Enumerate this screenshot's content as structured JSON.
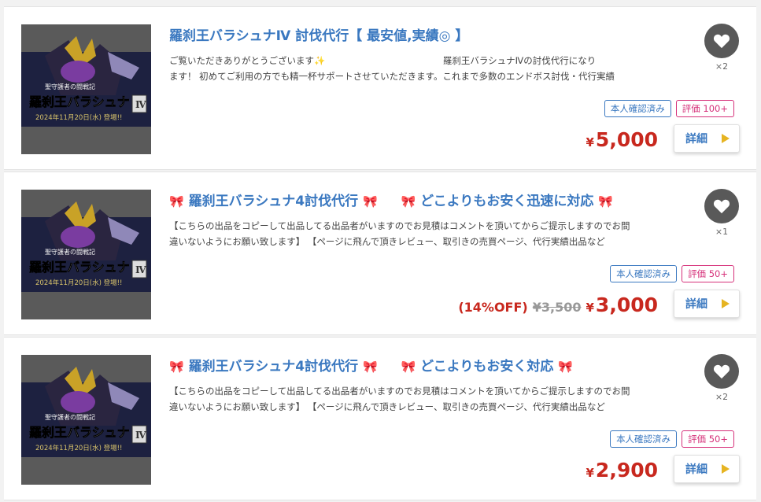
{
  "listings": [
    {
      "title": "羅刹王バラシュナⅣ 討伐代行【 最安値,実績◎ 】",
      "title_ribbons": false,
      "title_part1": "",
      "title_part2": "",
      "description_line1": "ご覧いただきありがとうございます✨　　　　　　　　　　　　　羅刹王バラシュナⅣの討伐代行になり",
      "description_line2": "ます！ 初めてご利用の方でも精一杯サポートさせていただきます。これまで多数のエンドボス討伐・代行実績",
      "favorite_count": "×2",
      "badge_verified": "本人確認済み",
      "badge_rating": "評価 100+",
      "discount_label": "",
      "original_price": "",
      "currency": "¥",
      "price": "5,000",
      "detail_label": "詳細"
    },
    {
      "title": "",
      "title_ribbons": true,
      "title_part1": "羅刹王バラシュナ4討伐代行",
      "title_part2": "どこよりもお安く迅速に対応",
      "description_line1": "【こちらの出品をコピーして出品してる出品者がいますのでお見積はコメントを頂いてからご提示しますのでお間",
      "description_line2": "違いないようにお願い致します】 【ページに飛んで頂きレビュー、取引きの売買ページ、代行実績出品など",
      "favorite_count": "×1",
      "badge_verified": "本人確認済み",
      "badge_rating": "評価 50+",
      "discount_label": "(14%OFF)",
      "original_price": "¥3,500",
      "currency": "¥",
      "price": "3,000",
      "detail_label": "詳細"
    },
    {
      "title": "",
      "title_ribbons": true,
      "title_part1": "羅刹王バラシュナ4討伐代行",
      "title_part2": "どこよりもお安く対応",
      "description_line1": "【こちらの出品をコピーして出品してる出品者がいますのでお見積はコメントを頂いてからご提示しますのでお間",
      "description_line2": "違いないようにお願い致します】 【ページに飛んで頂きレビュー、取引きの売買ページ、代行実績出品など",
      "favorite_count": "×2",
      "badge_verified": "本人確認済み",
      "badge_rating": "評価 50+",
      "discount_label": "",
      "original_price": "",
      "currency": "¥",
      "price": "2,900",
      "detail_label": "詳細"
    }
  ],
  "thumbnail": {
    "caption_small": "聖守護者の闘戦記",
    "caption_main": "羅刹王バラシュナ",
    "caption_date": "2024年11月20日(水) 登場!!",
    "badge_text": "Ⅳ"
  },
  "colors": {
    "title_blue": "#3a78c0",
    "price_red": "#c8281e",
    "rating_pink": "#d6317a",
    "ribbon_red": "#e33a55",
    "play_yellow": "#e6b422"
  },
  "icons": {
    "favorite": "heart-icon",
    "detail_arrow": "play-icon",
    "title_ribbon": "ribbon-icon"
  }
}
